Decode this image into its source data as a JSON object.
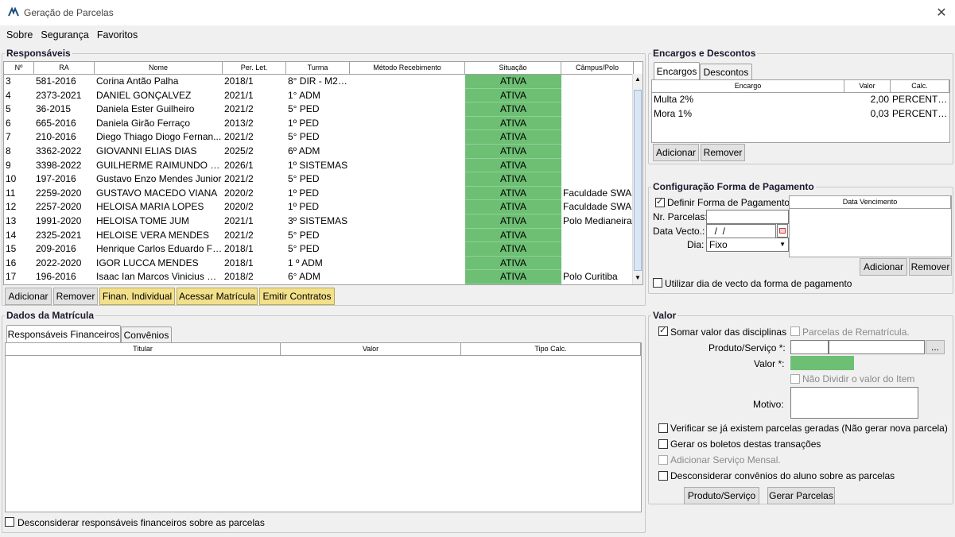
{
  "window": {
    "title": "Geração de Parcelas"
  },
  "menu": [
    "Sobre",
    "Segurança",
    "Favoritos"
  ],
  "responsaveis": {
    "title": "Responsáveis",
    "columns": [
      "Nº",
      "RA",
      "Nome",
      "Per. Let.",
      "Turma",
      "Método Recebimento",
      "Situação",
      "Câmpus/Polo"
    ],
    "rows": [
      [
        "3",
        "581-2016",
        "Corina Antão Palha",
        "2018/1",
        "8° DIR - M20...",
        "",
        "ATIVA",
        ""
      ],
      [
        "4",
        "2373-2021",
        "DANIEL GONÇALVEZ",
        "2021/1",
        "1° ADM",
        "",
        "ATIVA",
        ""
      ],
      [
        "5",
        "36-2015",
        "Daniela Ester Guilheiro",
        "2021/2",
        "5° PED",
        "",
        "ATIVA",
        ""
      ],
      [
        "6",
        "665-2016",
        "Daniela Girão Ferraço",
        "2013/2",
        "1º PED",
        "",
        "ATIVA",
        ""
      ],
      [
        "7",
        "210-2016",
        "Diego Thiago Diogo Fernan...",
        "2021/2",
        "5° PED",
        "",
        "ATIVA",
        ""
      ],
      [
        "8",
        "3362-2022",
        "GIOVANNI ELIAS DIAS",
        "2025/2",
        "6º ADM",
        "",
        "ATIVA",
        ""
      ],
      [
        "9",
        "3398-2022",
        "GUILHERME RAIMUNDO RO...",
        "2026/1",
        "1º SISTEMAS",
        "",
        "ATIVA",
        ""
      ],
      [
        "10",
        "197-2016",
        "Gustavo Enzo Mendes Junior",
        "2021/2",
        "5° PED",
        "",
        "ATIVA",
        ""
      ],
      [
        "11",
        "2259-2020",
        "GUSTAVO MACEDO VIANA",
        "2020/2",
        "1º PED",
        "",
        "ATIVA",
        "Faculdade SWA"
      ],
      [
        "12",
        "2257-2020",
        "HELOISA MARIA LOPES",
        "2020/2",
        "1º PED",
        "",
        "ATIVA",
        "Faculdade SWA"
      ],
      [
        "13",
        "1991-2020",
        "HELOISA TOME JUM",
        "2021/1",
        "3º SISTEMAS",
        "",
        "ATIVA",
        "Polo Medianeira"
      ],
      [
        "14",
        "2325-2021",
        "HELOISE VERA MENDES",
        "2021/2",
        "5° PED",
        "",
        "ATIVA",
        ""
      ],
      [
        "15",
        "209-2016",
        "Henrique Carlos Eduardo Fr...",
        "2018/1",
        "5° PED",
        "",
        "ATIVA",
        ""
      ],
      [
        "16",
        "2022-2020",
        "IGOR LUCCA MENDES",
        "2018/1",
        "1 º ADM",
        "",
        "ATIVA",
        ""
      ],
      [
        "17",
        "196-2016",
        "Isaac Ian Marcos Vinicius M...",
        "2018/2",
        "6° ADM",
        "",
        "ATIVA",
        "Polo Curitiba"
      ]
    ],
    "buttons": {
      "adicionar": "Adicionar",
      "remover": "Remover",
      "finan": "Finan. Individual",
      "acessar": "Acessar Matrícula",
      "emitir": "Emitir Contratos"
    }
  },
  "encargos": {
    "title": "Encargos e Descontos",
    "tabs": [
      "Encargos",
      "Descontos"
    ],
    "columns": [
      "Encargo",
      "Valor",
      "Calc."
    ],
    "rows": [
      [
        "Multa 2%",
        "2,00",
        "PERCENTUAL"
      ],
      [
        "Mora 1%",
        "0,03",
        "PERCENTUAL"
      ]
    ],
    "buttons": {
      "adicionar": "Adicionar",
      "remover": "Remover"
    }
  },
  "config": {
    "title": "Configuração Forma de Pagamento",
    "definir_label": "Definir Forma de Pagamento",
    "data_venc_header": "Data Vencimento",
    "nr_parcelas_label": "Nr. Parcelas:",
    "data_vecto_label": "Data Vecto.:",
    "data_vecto_value": "  /  /",
    "dia_label": "Dia:",
    "dia_value": "Fixo",
    "buttons": {
      "adicionar": "Adicionar",
      "remover": "Remover"
    },
    "utilizar_label": "Utilizar dia de vecto da forma de pagamento"
  },
  "dados": {
    "title": "Dados da Matrícula",
    "tabs": [
      "Responsáveis Financeiros",
      "Convênios"
    ],
    "columns": [
      "Titular",
      "Valor",
      "Tipo Calc."
    ],
    "desconsiderar_label": "Desconsiderar responsáveis financeiros sobre as parcelas"
  },
  "valor": {
    "title": "Valor",
    "somar_label": "Somar valor das disciplinas",
    "parcelas_remat_label": "Parcelas de Rematrícula.",
    "produto_label": "Produto/Serviço *:",
    "produto_btn": "...",
    "valor_label": "Valor *:",
    "nao_dividir_label": "Não Dividir o valor do Item",
    "motivo_label": "Motivo:",
    "verificar_label": "Verificar se já existem parcelas geradas (Não gerar nova parcela)",
    "gerar_boletos_label": "Gerar os boletos destas transações",
    "adicionar_servico_label": "Adicionar Serviço Mensal.",
    "desconsiderar_conv_label": "Desconsiderar convênios do aluno sobre as parcelas",
    "buttons": {
      "produto": "Produto/Serviço",
      "gerar": "Gerar Parcelas"
    }
  },
  "colors": {
    "status_green": "#6dbf74",
    "accent_yellow": "#f2e08a"
  }
}
